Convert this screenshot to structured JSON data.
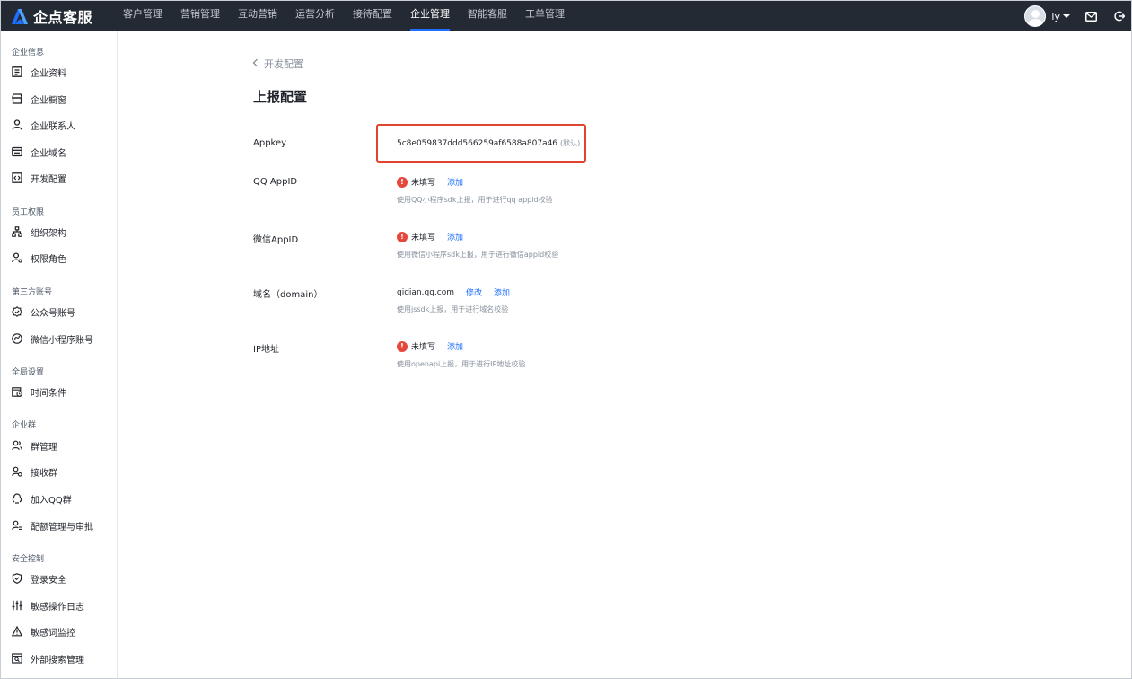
{
  "app": {
    "name": "企点客服",
    "brand_color": "#1e6fff"
  },
  "nav": {
    "items": [
      {
        "label": "客户管理"
      },
      {
        "label": "营销管理"
      },
      {
        "label": "互动营销"
      },
      {
        "label": "运营分析"
      },
      {
        "label": "接待配置"
      },
      {
        "label": "企业管理",
        "active": true
      },
      {
        "label": "智能客服"
      },
      {
        "label": "工单管理"
      }
    ]
  },
  "user": {
    "name": "ly"
  },
  "sidebar": {
    "groups": [
      {
        "title": "企业信息",
        "items": [
          {
            "label": "企业资料",
            "icon": "document-icon"
          },
          {
            "label": "企业橱窗",
            "icon": "storefront-icon"
          },
          {
            "label": "企业联系人",
            "icon": "person-icon"
          },
          {
            "label": "企业域名",
            "icon": "domain-icon"
          },
          {
            "label": "开发配置",
            "icon": "code-icon"
          }
        ]
      },
      {
        "title": "员工权限",
        "items": [
          {
            "label": "组织架构",
            "icon": "org-chart-icon"
          },
          {
            "label": "权限角色",
            "icon": "user-role-icon"
          }
        ]
      },
      {
        "title": "第三方账号",
        "items": [
          {
            "label": "公众号账号",
            "icon": "badge-icon"
          },
          {
            "label": "微信小程序账号",
            "icon": "mini-program-icon"
          }
        ]
      },
      {
        "title": "全局设置",
        "items": [
          {
            "label": "时间条件",
            "icon": "calendar-clock-icon"
          }
        ]
      },
      {
        "title": "企业群",
        "items": [
          {
            "label": "群管理",
            "icon": "group-icon"
          },
          {
            "label": "接收群",
            "icon": "group-receive-icon"
          },
          {
            "label": "加入QQ群",
            "icon": "qq-group-icon"
          },
          {
            "label": "配额管理与审批",
            "icon": "quota-icon"
          }
        ]
      },
      {
        "title": "安全控制",
        "items": [
          {
            "label": "登录安全",
            "icon": "shield-icon"
          },
          {
            "label": "敏感操作日志",
            "icon": "sliders-icon"
          },
          {
            "label": "敏感词监控",
            "icon": "warning-triangle-icon"
          },
          {
            "label": "外部搜索管理",
            "icon": "search-window-icon"
          }
        ]
      }
    ]
  },
  "main": {
    "back_label": "开发配置",
    "title": "上报配置",
    "appkey": {
      "label": "Appkey",
      "value": "5c8e059837ddd566259af6588a807a46",
      "tag": "(默认)"
    },
    "qq_appid": {
      "label": "QQ AppID",
      "status": "未填写",
      "action": "添加",
      "hint": "使用QQ小程序sdk上报，用于进行qq appid校验"
    },
    "wechat_appid": {
      "label": "微信AppID",
      "status": "未填写",
      "action": "添加",
      "hint": "使用微信小程序sdk上报，用于进行微信appid校验"
    },
    "domain": {
      "label": "域名（domain）",
      "value": "qidian.qq.com",
      "edit_action": "修改",
      "add_action": "添加",
      "hint": "使用jssdk上报，用于进行域名校验"
    },
    "ip": {
      "label": "IP地址",
      "status": "未填写",
      "action": "添加",
      "hint": "使用openapi上报，用于进行IP地址校验"
    }
  }
}
